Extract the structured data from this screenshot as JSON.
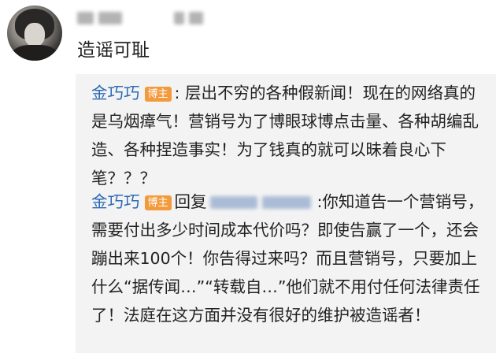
{
  "comment": {
    "text": "造谣可耻"
  },
  "replies": [
    {
      "author": "金巧巧",
      "badge": "博主",
      "text": ": 层出不穷的各种假新闻！现在的网络真的是乌烟瘴气！营销号为了博眼球博点击量、各种胡编乱造、各种捏造事实！为了钱真的就可以昧着良心下笔？？？"
    },
    {
      "author": "金巧巧",
      "badge": "博主",
      "reply_prefix": "回复",
      "text": ":你知道告一个营销号，需要付出多少时间成本代价吗？即使告赢了一个，还会蹦出来100个！你告得过来吗？而且营销号，只要加上什么“据传闻…”“转载自…”他们就不用付任何法律责任了！法庭在这方面并没有很好的维护被造谣者！"
    }
  ],
  "colors": {
    "nickname": "#2c6bb6",
    "badge_bg": "#f29a3c",
    "reply_bg": "#f3f3f3"
  },
  "icons": {
    "avatar": "user-avatar-photo"
  }
}
